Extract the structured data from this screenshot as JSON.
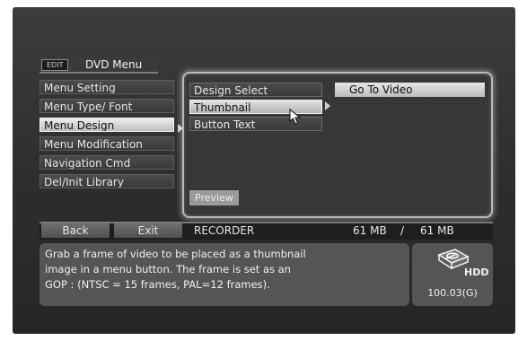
{
  "header": {
    "badge": "EDIT",
    "title": "DVD Menu"
  },
  "left_menu": {
    "items": [
      {
        "label": "Menu Setting"
      },
      {
        "label": "Menu Type/ Font"
      },
      {
        "label": "Menu Design"
      },
      {
        "label": "Menu Modification"
      },
      {
        "label": "Navigation Cmd"
      },
      {
        "label": "Del/Init Library"
      }
    ],
    "selected": "Menu Design"
  },
  "sub_menu": {
    "items": [
      {
        "label": "Design Select"
      },
      {
        "label": "Thumbnail"
      },
      {
        "label": "Button Text"
      }
    ],
    "selected": "Thumbnail"
  },
  "option": {
    "label": "Go To Video"
  },
  "preview_label": "Preview",
  "bottom_bar": {
    "back_label": "Back",
    "exit_label": "Exit",
    "source": "RECORDER",
    "used": "61 MB",
    "separator": "/",
    "total": "61 MB"
  },
  "description": {
    "lines": [
      "Grab a frame of video to be placed as a thumbnail",
      "image in a menu button. The frame is set as an",
      "GOP : (NTSC = 15 frames, PAL=12 frames)."
    ]
  },
  "hdd": {
    "label": "HDD",
    "capacity": "100.03(G)",
    "icon": "hdd-icon"
  }
}
